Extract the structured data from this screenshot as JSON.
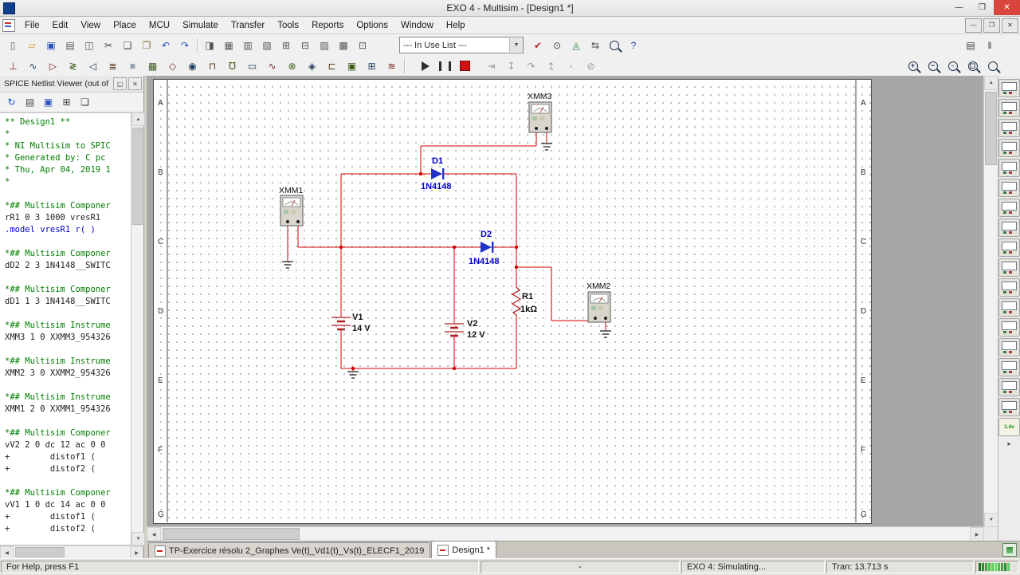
{
  "titlebar": {
    "title": "EXO 4 - Multisim - [Design1 *]",
    "minimize": "—",
    "maximize": "❒",
    "close": "✕"
  },
  "menubar": {
    "items": [
      "File",
      "Edit",
      "View",
      "Place",
      "MCU",
      "Simulate",
      "Transfer",
      "Tools",
      "Reports",
      "Options",
      "Window",
      "Help"
    ],
    "mdi": {
      "minimize": "—",
      "restore": "❒",
      "close": "✕"
    }
  },
  "toolbar1": {
    "file_group": [
      {
        "n": "new-button",
        "g": "▯",
        "c": "#666666"
      },
      {
        "n": "open-button",
        "g": "▱",
        "c": "#c8a02a"
      },
      {
        "n": "save-button",
        "g": "▣",
        "c": "#2a52be"
      },
      {
        "n": "print-button",
        "g": "▤",
        "c": "#555555"
      },
      {
        "n": "print-preview-button",
        "g": "◫",
        "c": "#555555"
      },
      {
        "n": "cut-button",
        "g": "✂",
        "c": "#444444"
      },
      {
        "n": "copy-button",
        "g": "❏",
        "c": "#444444"
      },
      {
        "n": "paste-button",
        "g": "❐",
        "c": "#8a6d3b"
      },
      {
        "n": "undo-button",
        "g": "↶",
        "c": "#2a52be"
      },
      {
        "n": "redo-button",
        "g": "↷",
        "c": "#2a52be"
      }
    ],
    "view_group": [
      {
        "n": "toggle-design-toolbox-button",
        "g": "◨",
        "c": "#555555"
      },
      {
        "n": "toggle-spreadsheet-view-button",
        "g": "▦",
        "c": "#555555"
      },
      {
        "n": "toggle-spice-netlist-viewer-button",
        "g": "▥",
        "c": "#555555"
      },
      {
        "n": "graphers-button",
        "g": "▧",
        "c": "#555555"
      },
      {
        "n": "postprocessor-button",
        "g": "⊞",
        "c": "#555555"
      },
      {
        "n": "parent-sheet-button",
        "g": "⊟",
        "c": "#555555"
      },
      {
        "n": "new-window-button",
        "g": "▨",
        "c": "#555555"
      },
      {
        "n": "close-window-button",
        "g": "▩",
        "c": "#555555"
      },
      {
        "n": "description-box-button",
        "g": "⊡",
        "c": "#555555"
      }
    ],
    "in_use_list": "--- In Use List ---",
    "combo_arrow": "▼",
    "tool_group": [
      {
        "n": "erc-button",
        "g": "✔",
        "c": "#b22222"
      },
      {
        "n": "capture-area-button",
        "g": "⊙",
        "c": "#444444"
      },
      {
        "n": "breadboard-button",
        "g": "◬",
        "c": "#2e7d32"
      },
      {
        "n": "back-annotate-button",
        "g": "⇆",
        "c": "#444444"
      },
      {
        "n": "find-button",
        "mag": ""
      },
      {
        "n": "help-button",
        "g": "?",
        "c": "#1b3fb0"
      }
    ],
    "far_right": [
      {
        "n": "sheet-list-button",
        "g": "▤",
        "c": "#444444"
      },
      {
        "n": "simulate-pause-button",
        "g": "‖",
        "c": "#444444"
      }
    ]
  },
  "toolbar2": {
    "components": [
      {
        "n": "place-source-button",
        "g": "⊥",
        "c": "#7a1f1f"
      },
      {
        "n": "place-basic-button",
        "g": "∿",
        "c": "#1a3a5a"
      },
      {
        "n": "place-diode-button",
        "g": "▷",
        "c": "#7a1f1f"
      },
      {
        "n": "place-transistor-button",
        "g": "≷",
        "c": "#3a5a1a"
      },
      {
        "n": "place-analog-button",
        "g": "◁",
        "c": "#1a3a5a"
      },
      {
        "n": "place-ttl-button",
        "g": "≣",
        "c": "#5a3a1a"
      },
      {
        "n": "place-cmos-button",
        "g": "≡",
        "c": "#1a3a5a"
      },
      {
        "n": "place-misc-digital-button",
        "g": "▦",
        "c": "#3a5a1a"
      },
      {
        "n": "place-mixed-button",
        "g": "◇",
        "c": "#7a1f1f"
      },
      {
        "n": "place-indicator-button",
        "g": "◉",
        "c": "#1a3a5a"
      },
      {
        "n": "place-power-component-button",
        "g": "⊓",
        "c": "#5a3a1a"
      },
      {
        "n": "place-misc-button",
        "g": "℧",
        "c": "#3a5a1a"
      },
      {
        "n": "place-advanced-peripherals-button",
        "g": "▭",
        "c": "#1a3a5a"
      },
      {
        "n": "place-rf-button",
        "g": "∿",
        "c": "#7a1f1f"
      },
      {
        "n": "place-electromechanical-button",
        "g": "⊗",
        "c": "#3a5a1a"
      },
      {
        "n": "place-ni-component-button",
        "g": "◈",
        "c": "#1a3a5a"
      },
      {
        "n": "place-connector-button",
        "g": "⊏",
        "c": "#5a3a1a"
      },
      {
        "n": "place-mcu-button",
        "g": "▣",
        "c": "#3a5a1a"
      },
      {
        "n": "place-hierarchical-block-button",
        "g": "⊞",
        "c": "#1a3a5a"
      },
      {
        "n": "place-bus-button",
        "g": "≋",
        "c": "#7a1f1f"
      }
    ],
    "sim_controls": [
      {
        "n": "run-button",
        "shape": "shp-play"
      },
      {
        "n": "pause-simulation-button",
        "shape": "shp-pause"
      },
      {
        "n": "stop-button",
        "shape": "shp-stop"
      }
    ],
    "sim_extra": [
      {
        "n": "pause-at-next-mcu-button",
        "g": "⇥",
        "c": "#999999"
      },
      {
        "n": "step-into-button",
        "g": "↧",
        "c": "#999999"
      },
      {
        "n": "step-over-button",
        "g": "↷",
        "c": "#999999"
      },
      {
        "n": "step-out-button",
        "g": "↥",
        "c": "#999999"
      },
      {
        "n": "toggle-breakpoint-button",
        "g": "◦",
        "c": "#999999"
      },
      {
        "n": "remove-breakpoint-button",
        "g": "⊘",
        "c": "#999999"
      }
    ],
    "zoom": [
      {
        "n": "zoom-in-button",
        "mag": "+"
      },
      {
        "n": "zoom-out-button",
        "mag": "−"
      },
      {
        "n": "zoom-area-button",
        "mag": "▫"
      },
      {
        "n": "zoom-fit-button",
        "mag": "◻"
      },
      {
        "n": "zoom-fullscreen-button",
        "mag": ""
      }
    ]
  },
  "netlist_panel": {
    "title": "SPICE Netlist Viewer (out of",
    "menu_btn": "◱",
    "close_btn": "✕",
    "toolbar": [
      {
        "n": "refresh-netlist-button",
        "g": "↻",
        "c": "#1550c8"
      },
      {
        "n": "print-netlist-button",
        "g": "▤",
        "c": "#444444"
      },
      {
        "n": "save-netlist-button",
        "g": "▣",
        "c": "#2a52be"
      },
      {
        "n": "netlist-options-button",
        "g": "⊞",
        "c": "#444444"
      },
      {
        "n": "copy-netlist-button",
        "g": "❏",
        "c": "#444444"
      }
    ],
    "lines": [
      {
        "t": "** Design1 **",
        "c": "c"
      },
      {
        "t": "*",
        "c": "c"
      },
      {
        "t": "* NI Multisim to SPIC",
        "c": "c"
      },
      {
        "t": "* Generated by: C pc",
        "c": "c"
      },
      {
        "t": "* Thu, Apr 04, 2019 1",
        "c": "c"
      },
      {
        "t": "*",
        "c": "c"
      },
      {
        "t": "",
        "c": "n"
      },
      {
        "t": "*## Multisim Componer",
        "c": "c"
      },
      {
        "t": "rR1 0 3 1000 vresR1",
        "c": "n"
      },
      {
        "t": ".model vresR1 r( )",
        "c": "k"
      },
      {
        "t": "",
        "c": "n"
      },
      {
        "t": "*## Multisim Componer",
        "c": "c"
      },
      {
        "t": "dD2 2 3 1N4148__SWITC",
        "c": "n"
      },
      {
        "t": "",
        "c": "n"
      },
      {
        "t": "*## Multisim Componer",
        "c": "c"
      },
      {
        "t": "dD1 1 3 1N4148__SWITC",
        "c": "n"
      },
      {
        "t": "",
        "c": "n"
      },
      {
        "t": "*## Multisim Instrume",
        "c": "c"
      },
      {
        "t": "XMM3 1 0 XXMM3_954326",
        "c": "n"
      },
      {
        "t": "",
        "c": "n"
      },
      {
        "t": "*## Multisim Instrume",
        "c": "c"
      },
      {
        "t": "XMM2 3 0 XXMM2_954326",
        "c": "n"
      },
      {
        "t": "",
        "c": "n"
      },
      {
        "t": "*## Multisim Instrume",
        "c": "c"
      },
      {
        "t": "XMM1 2 0 XXMM1_954326",
        "c": "n"
      },
      {
        "t": "",
        "c": "n"
      },
      {
        "t": "*## Multisim Componer",
        "c": "c"
      },
      {
        "t": "vV2 2 0 dc 12 ac 0 0",
        "c": "n"
      },
      {
        "t": "+        distof1 (",
        "c": "n"
      },
      {
        "t": "+        distof2 (",
        "c": "n"
      },
      {
        "t": "",
        "c": "n"
      },
      {
        "t": "*## Multisim Componer",
        "c": "c"
      },
      {
        "t": "vV1 1 0 dc 14 ac 0 0",
        "c": "n"
      },
      {
        "t": "+        distof1 (",
        "c": "n"
      },
      {
        "t": "+        distof2 (",
        "c": "n"
      }
    ]
  },
  "schematic": {
    "row_labels": [
      "A",
      "B",
      "C",
      "D",
      "E",
      "F",
      "G"
    ],
    "xmm1": "XMM1",
    "xmm2": "XMM2",
    "xmm3": "XMM3",
    "d1_ref": "D1",
    "d1_val": "1N4148",
    "d2_ref": "D2",
    "d2_val": "1N4148",
    "r1_ref": "R1",
    "r1_val": "1kΩ",
    "v1_ref": "V1",
    "v1_val": "14 V",
    "v2_ref": "V2",
    "v2_val": "12 V",
    "wire_color": "#d40000",
    "component_color": "#b22222",
    "diode_color": "#2233cc"
  },
  "instruments": {
    "items": [
      "multimeter",
      "function-generator",
      "wattmeter",
      "oscilloscope",
      "four-channel-oscilloscope",
      "bode-plotter",
      "frequency-counter",
      "word-generator",
      "logic-converter",
      "logic-analyzer",
      "iv-analyzer",
      "distortion-analyzer",
      "spectrum-analyzer",
      "network-analyzer",
      "agilent-function-generator",
      "agilent-multimeter",
      "tektronix-oscilloscope"
    ],
    "probe_label": "1.4v",
    "more": "▸"
  },
  "tabs": {
    "items": [
      {
        "label": "TP-Exercice résolu 2_Graphes Ve(t)_Vd1(t)_Vs(t)_ELECF1_2019",
        "active": false
      },
      {
        "label": "Design1 *",
        "active": true
      }
    ]
  },
  "statusbar": {
    "help": "For Help, press F1",
    "dash": "-",
    "sim": "EXO 4: Simulating...",
    "tran": "Tran: 13.713 s"
  },
  "ui": {
    "up": "▲",
    "down": "▼",
    "left": "◀",
    "right": "▶"
  }
}
